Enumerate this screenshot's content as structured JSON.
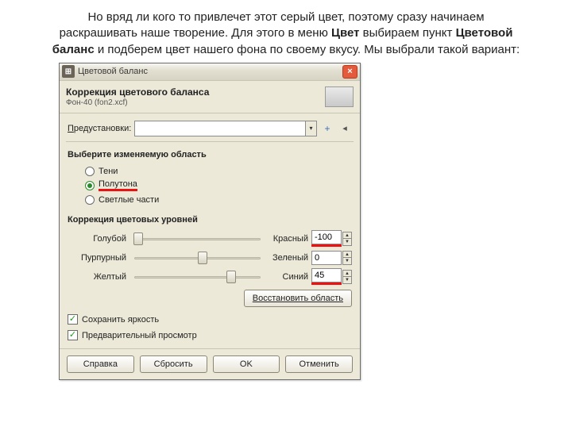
{
  "caption": {
    "t1": "Но вряд ли кого то привлечет этот серый цвет, поэтому сразу начинаем раскрашивать наше творение. Для этого в меню ",
    "b1": "Цвет",
    "t2": " выбираем пункт ",
    "b2": "Цветовой баланс",
    "t3": " и подберем цвет нашего фона по своему вкусу. Мы выбрали такой вариант:"
  },
  "titlebar": {
    "title": "Цветовой баланс",
    "close_glyph": "×"
  },
  "header": {
    "title": "Коррекция цветового баланса",
    "subtitle": "Фон-40 (fon2.xcf)"
  },
  "presets": {
    "label": "Предустановки:",
    "value": "",
    "plus_glyph": "+",
    "menu_glyph": "◂"
  },
  "range_section": {
    "title": "Выберите изменяемую область"
  },
  "ranges": {
    "shadows": "Тени",
    "midtones": "Полутона",
    "highlights": "Светлые части",
    "selected": "midtones"
  },
  "levels_section": {
    "title": "Коррекция цветовых уровней"
  },
  "sliders": [
    {
      "left": "Голубой",
      "right": "Красный",
      "value": "-100",
      "pos": 2,
      "highlight": true
    },
    {
      "left": "Пурпурный",
      "right": "Зеленый",
      "value": "0",
      "pos": 50,
      "highlight": false
    },
    {
      "left": "Желтый",
      "right": "Синий",
      "value": "45",
      "pos": 72,
      "highlight": true
    }
  ],
  "buttons": {
    "restore": "Восстановить область",
    "help": "Справка",
    "reset": "Сбросить",
    "ok": "OK",
    "cancel": "Отменить"
  },
  "checks": {
    "preserve_lum": "Сохранить яркость",
    "preview": "Предварительный просмотр"
  }
}
